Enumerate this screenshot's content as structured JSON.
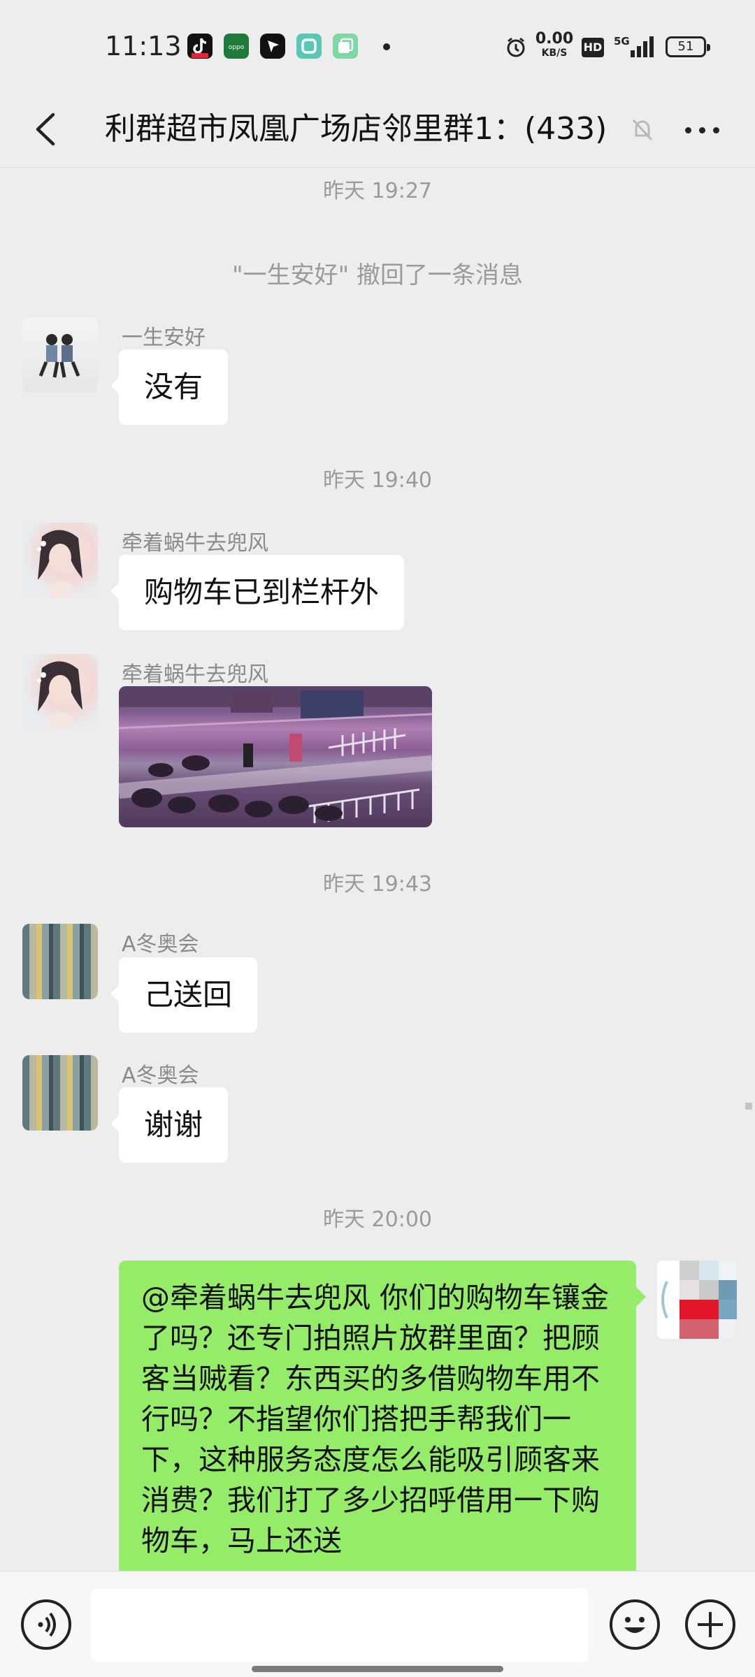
{
  "status_bar": {
    "time": "11:13",
    "net_speed": "0.00",
    "net_unit": "KB/S",
    "hd_label": "HD",
    "network_label": "5G",
    "battery": "51",
    "icons": [
      "tiktok-icon",
      "oppo-store-icon",
      "arrow-app-icon",
      "camera-app-icon",
      "gallery-app-icon",
      "alarm-icon",
      "signal-icon",
      "battery-icon"
    ]
  },
  "nav": {
    "title": "利群超市凤凰广场店邻里群1：(433)",
    "icons": [
      "back-arrow-icon",
      "mute-bell-icon",
      "more-icon"
    ]
  },
  "messages": [
    {
      "type": "time",
      "text": "昨天 19:27"
    },
    {
      "type": "system",
      "text": "\"一生安好\" 撤回了一条消息"
    },
    {
      "type": "text",
      "sender": "一生安好",
      "text": "没有"
    },
    {
      "type": "time",
      "text": "昨天 19:40"
    },
    {
      "type": "text",
      "sender": "牵着蜗牛去兜风",
      "text": "购物车已到栏杆外"
    },
    {
      "type": "image",
      "sender": "牵着蜗牛去兜风"
    },
    {
      "type": "time",
      "text": "昨天 19:43"
    },
    {
      "type": "text",
      "sender": "A冬奥会",
      "text": "己送回"
    },
    {
      "type": "text",
      "sender": "A冬奥会",
      "text": "谢谢"
    },
    {
      "type": "time",
      "text": "昨天 20:00"
    },
    {
      "type": "self",
      "text": "@牵着蜗牛去兜风  你们的购物车镶金了吗？还专门拍照片放群里面？把顾客当贼看？东西买的多借购物车用不行吗？不指望你们搭把手帮我们一下，这种服务态度怎么能吸引顾客来消费？我们打了多少招呼借用一下购物车，马上还送"
    }
  ],
  "input_bar": {
    "placeholder": "",
    "icons": [
      "voice-icon",
      "emoji-icon",
      "plus-icon"
    ]
  }
}
